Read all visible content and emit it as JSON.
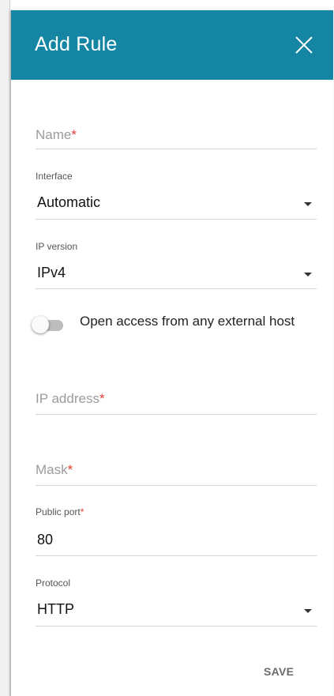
{
  "dialog": {
    "title": "Add Rule",
    "close_icon": "close-icon",
    "header_color": "#1486a3"
  },
  "form": {
    "name": {
      "placeholder": "Name",
      "required_mark": "*",
      "value": ""
    },
    "interface": {
      "label": "Interface",
      "value": "Automatic"
    },
    "ip_version": {
      "label": "IP version",
      "value": "IPv4"
    },
    "open_access": {
      "label": "Open access from any external host",
      "enabled": false
    },
    "ip_address": {
      "placeholder": "IP address",
      "required_mark": "*",
      "value": ""
    },
    "mask": {
      "placeholder": "Mask",
      "required_mark": "*",
      "value": ""
    },
    "public_port": {
      "label": "Public port",
      "required_mark": "*",
      "value": "80"
    },
    "protocol": {
      "label": "Protocol",
      "value": "HTTP"
    }
  },
  "actions": {
    "save_label": "SAVE"
  }
}
